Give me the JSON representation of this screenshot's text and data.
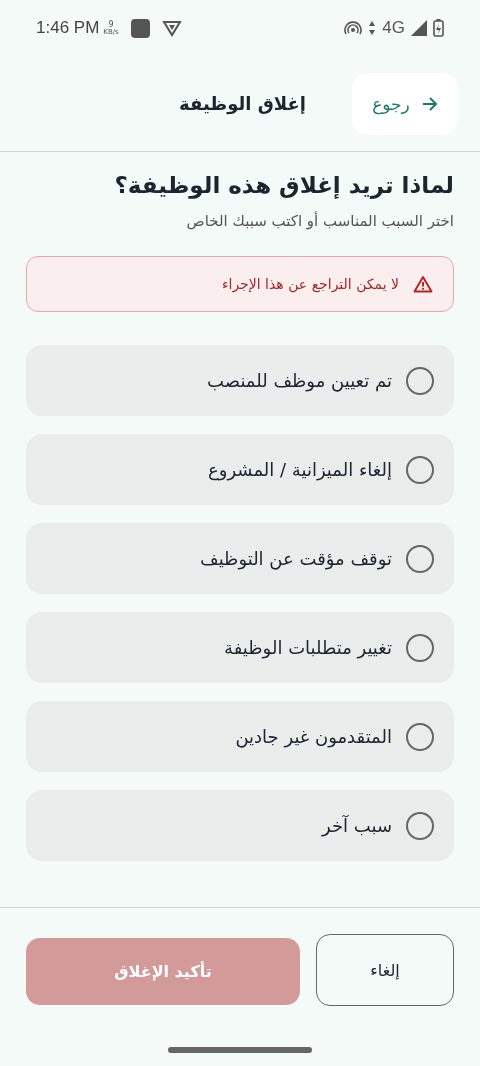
{
  "status_bar": {
    "time": "1:46 PM",
    "speed_value": "9",
    "speed_unit": "KB/s",
    "network": "4G"
  },
  "header": {
    "back_button": {
      "label": "رجوع"
    },
    "title": "إغلاق الوظيفة"
  },
  "question": "لماذا تريد إغلاق هذه الوظيفة؟",
  "subtitle": "اختر السبب المناسب أو اكتب سببك الخاص",
  "warning": "لا يمكن التراجع عن هذا الإجراء",
  "reasons": [
    {
      "label": "تم تعيين موظف للمنصب",
      "selected": false
    },
    {
      "label": "إلغاء الميزانية / المشروع",
      "selected": false
    },
    {
      "label": "توقف مؤقت عن التوظيف",
      "selected": false
    },
    {
      "label": "تغيير متطلبات الوظيفة",
      "selected": false
    },
    {
      "label": "المتقدمون غير جادين",
      "selected": false
    },
    {
      "label": "سبب آخر",
      "selected": false
    }
  ],
  "buttons": [
    {
      "kind": "outline",
      "label": "إلغاء",
      "disabled": false
    },
    {
      "kind": "danger",
      "label": "تأكيد الإغلاق",
      "disabled": true
    }
  ]
}
